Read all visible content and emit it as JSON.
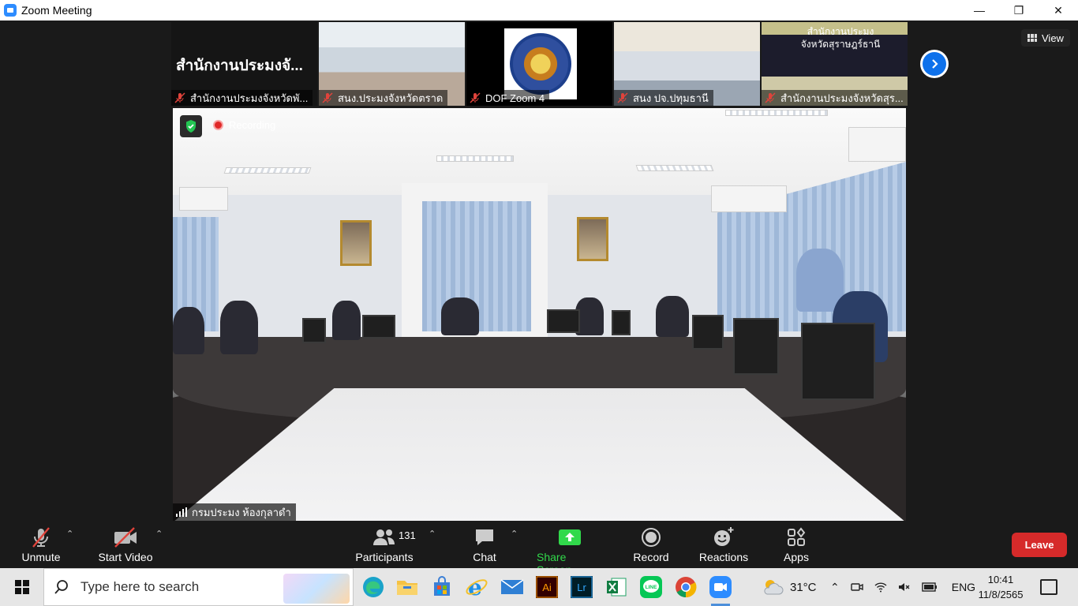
{
  "window": {
    "title": "Zoom Meeting",
    "controls": [
      "—",
      "❐",
      "✕"
    ]
  },
  "gallery": {
    "tiles": [
      {
        "name": "สำนักงานประมงจังหวัดพั...",
        "overlay_text": "สำนักงานประมงจั..."
      },
      {
        "name": "สนง.ประมงจังหวัดตราด"
      },
      {
        "name": "DOF Zoom 4"
      },
      {
        "name": "สนง ปจ.ปทุมธานี"
      },
      {
        "name": "สำนักงานประมงจังหวัดสุร...",
        "sign_text": "สำนักงานประมง จังหวัดสุราษฎร์ธานี"
      }
    ],
    "view_label": "View"
  },
  "main_video": {
    "recording_label": "Recording",
    "speaker_name": "กรมประมง ห้องกุลาดำ"
  },
  "toolbar": {
    "unmute": "Unmute",
    "start_video": "Start Video",
    "participants": "Participants",
    "participant_count": "131",
    "chat": "Chat",
    "share_screen": "Share Screen",
    "record": "Record",
    "reactions": "Reactions",
    "apps": "Apps",
    "leave": "Leave",
    "share_color": "#31d94b",
    "leave_color": "#d62a2a"
  },
  "taskbar": {
    "search_placeholder": "Type here to search",
    "apps": [
      "edge-icon",
      "file-explorer-icon",
      "store-icon",
      "internet-explorer-icon",
      "mail-icon",
      "illustrator-icon",
      "lightroom-icon",
      "excel-icon",
      "line-icon",
      "chrome-icon",
      "zoom-icon"
    ],
    "app_labels": {
      "illustrator": "Ai",
      "lightroom": "Lr",
      "line": "LINE"
    },
    "weather": "31°C",
    "language": "ENG",
    "time": "10:41",
    "date": "11/8/2565"
  }
}
